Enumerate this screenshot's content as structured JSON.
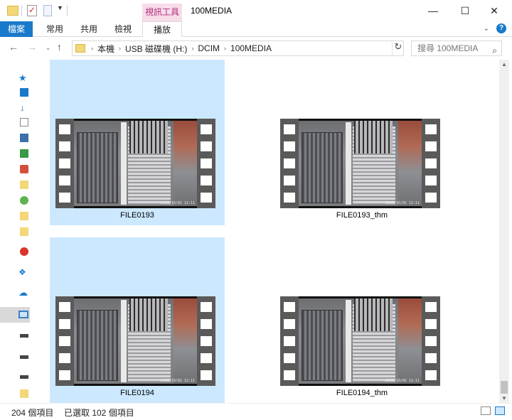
{
  "titlebar": {
    "context_tab_group": "視訊工具",
    "title": "100MEDIA",
    "minimize": "—",
    "maximize": "☐",
    "close": "✕"
  },
  "ribbon": {
    "tabs": [
      "檔案",
      "常用",
      "共用",
      "檢視",
      "播放"
    ]
  },
  "address": {
    "crumbs": [
      "本機",
      "USB 磁碟機 (H:)",
      "DCIM",
      "100MEDIA"
    ],
    "search_placeholder": "搜尋 100MEDIA"
  },
  "files": [
    {
      "name": "FILE0193",
      "selected": true,
      "timestamp": "2016/10/02 12:11"
    },
    {
      "name": "FILE0193_thm",
      "selected": false,
      "timestamp": "2016/10/02 12:11"
    },
    {
      "name": "FILE0194",
      "selected": true,
      "timestamp": "2016/10/02 12:11"
    },
    {
      "name": "FILE0194_thm",
      "selected": false,
      "timestamp": "2016/10/02 12:11"
    }
  ],
  "status": {
    "item_count": "204 個項目",
    "selected_count": "已選取 102 個項目"
  },
  "colors": {
    "accent": "#1979ca",
    "selection": "#cce8ff",
    "context_tab": "#f8dcea"
  }
}
